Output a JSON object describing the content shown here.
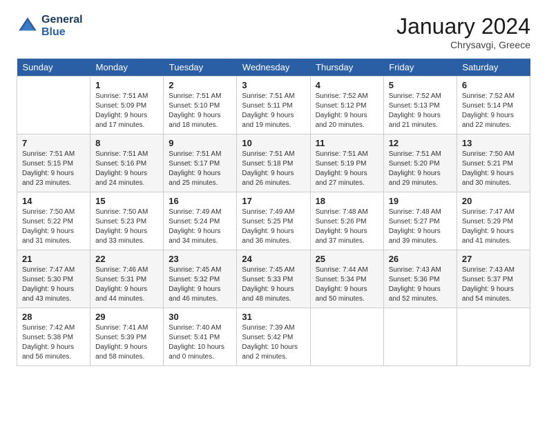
{
  "logo": {
    "line1": "General",
    "line2": "Blue"
  },
  "header": {
    "month": "January 2024",
    "location": "Chrysavgi, Greece"
  },
  "days_of_week": [
    "Sunday",
    "Monday",
    "Tuesday",
    "Wednesday",
    "Thursday",
    "Friday",
    "Saturday"
  ],
  "weeks": [
    [
      {
        "day": "",
        "content": ""
      },
      {
        "day": "1",
        "content": "Sunrise: 7:51 AM\nSunset: 5:09 PM\nDaylight: 9 hours\nand 17 minutes."
      },
      {
        "day": "2",
        "content": "Sunrise: 7:51 AM\nSunset: 5:10 PM\nDaylight: 9 hours\nand 18 minutes."
      },
      {
        "day": "3",
        "content": "Sunrise: 7:51 AM\nSunset: 5:11 PM\nDaylight: 9 hours\nand 19 minutes."
      },
      {
        "day": "4",
        "content": "Sunrise: 7:52 AM\nSunset: 5:12 PM\nDaylight: 9 hours\nand 20 minutes."
      },
      {
        "day": "5",
        "content": "Sunrise: 7:52 AM\nSunset: 5:13 PM\nDaylight: 9 hours\nand 21 minutes."
      },
      {
        "day": "6",
        "content": "Sunrise: 7:52 AM\nSunset: 5:14 PM\nDaylight: 9 hours\nand 22 minutes."
      }
    ],
    [
      {
        "day": "7",
        "content": "Sunrise: 7:51 AM\nSunset: 5:15 PM\nDaylight: 9 hours\nand 23 minutes."
      },
      {
        "day": "8",
        "content": "Sunrise: 7:51 AM\nSunset: 5:16 PM\nDaylight: 9 hours\nand 24 minutes."
      },
      {
        "day": "9",
        "content": "Sunrise: 7:51 AM\nSunset: 5:17 PM\nDaylight: 9 hours\nand 25 minutes."
      },
      {
        "day": "10",
        "content": "Sunrise: 7:51 AM\nSunset: 5:18 PM\nDaylight: 9 hours\nand 26 minutes."
      },
      {
        "day": "11",
        "content": "Sunrise: 7:51 AM\nSunset: 5:19 PM\nDaylight: 9 hours\nand 27 minutes."
      },
      {
        "day": "12",
        "content": "Sunrise: 7:51 AM\nSunset: 5:20 PM\nDaylight: 9 hours\nand 29 minutes."
      },
      {
        "day": "13",
        "content": "Sunrise: 7:50 AM\nSunset: 5:21 PM\nDaylight: 9 hours\nand 30 minutes."
      }
    ],
    [
      {
        "day": "14",
        "content": "Sunrise: 7:50 AM\nSunset: 5:22 PM\nDaylight: 9 hours\nand 31 minutes."
      },
      {
        "day": "15",
        "content": "Sunrise: 7:50 AM\nSunset: 5:23 PM\nDaylight: 9 hours\nand 33 minutes."
      },
      {
        "day": "16",
        "content": "Sunrise: 7:49 AM\nSunset: 5:24 PM\nDaylight: 9 hours\nand 34 minutes."
      },
      {
        "day": "17",
        "content": "Sunrise: 7:49 AM\nSunset: 5:25 PM\nDaylight: 9 hours\nand 36 minutes."
      },
      {
        "day": "18",
        "content": "Sunrise: 7:48 AM\nSunset: 5:26 PM\nDaylight: 9 hours\nand 37 minutes."
      },
      {
        "day": "19",
        "content": "Sunrise: 7:48 AM\nSunset: 5:27 PM\nDaylight: 9 hours\nand 39 minutes."
      },
      {
        "day": "20",
        "content": "Sunrise: 7:47 AM\nSunset: 5:29 PM\nDaylight: 9 hours\nand 41 minutes."
      }
    ],
    [
      {
        "day": "21",
        "content": "Sunrise: 7:47 AM\nSunset: 5:30 PM\nDaylight: 9 hours\nand 43 minutes."
      },
      {
        "day": "22",
        "content": "Sunrise: 7:46 AM\nSunset: 5:31 PM\nDaylight: 9 hours\nand 44 minutes."
      },
      {
        "day": "23",
        "content": "Sunrise: 7:45 AM\nSunset: 5:32 PM\nDaylight: 9 hours\nand 46 minutes."
      },
      {
        "day": "24",
        "content": "Sunrise: 7:45 AM\nSunset: 5:33 PM\nDaylight: 9 hours\nand 48 minutes."
      },
      {
        "day": "25",
        "content": "Sunrise: 7:44 AM\nSunset: 5:34 PM\nDaylight: 9 hours\nand 50 minutes."
      },
      {
        "day": "26",
        "content": "Sunrise: 7:43 AM\nSunset: 5:36 PM\nDaylight: 9 hours\nand 52 minutes."
      },
      {
        "day": "27",
        "content": "Sunrise: 7:43 AM\nSunset: 5:37 PM\nDaylight: 9 hours\nand 54 minutes."
      }
    ],
    [
      {
        "day": "28",
        "content": "Sunrise: 7:42 AM\nSunset: 5:38 PM\nDaylight: 9 hours\nand 56 minutes."
      },
      {
        "day": "29",
        "content": "Sunrise: 7:41 AM\nSunset: 5:39 PM\nDaylight: 9 hours\nand 58 minutes."
      },
      {
        "day": "30",
        "content": "Sunrise: 7:40 AM\nSunset: 5:41 PM\nDaylight: 10 hours\nand 0 minutes."
      },
      {
        "day": "31",
        "content": "Sunrise: 7:39 AM\nSunset: 5:42 PM\nDaylight: 10 hours\nand 2 minutes."
      },
      {
        "day": "",
        "content": ""
      },
      {
        "day": "",
        "content": ""
      },
      {
        "day": "",
        "content": ""
      }
    ]
  ]
}
